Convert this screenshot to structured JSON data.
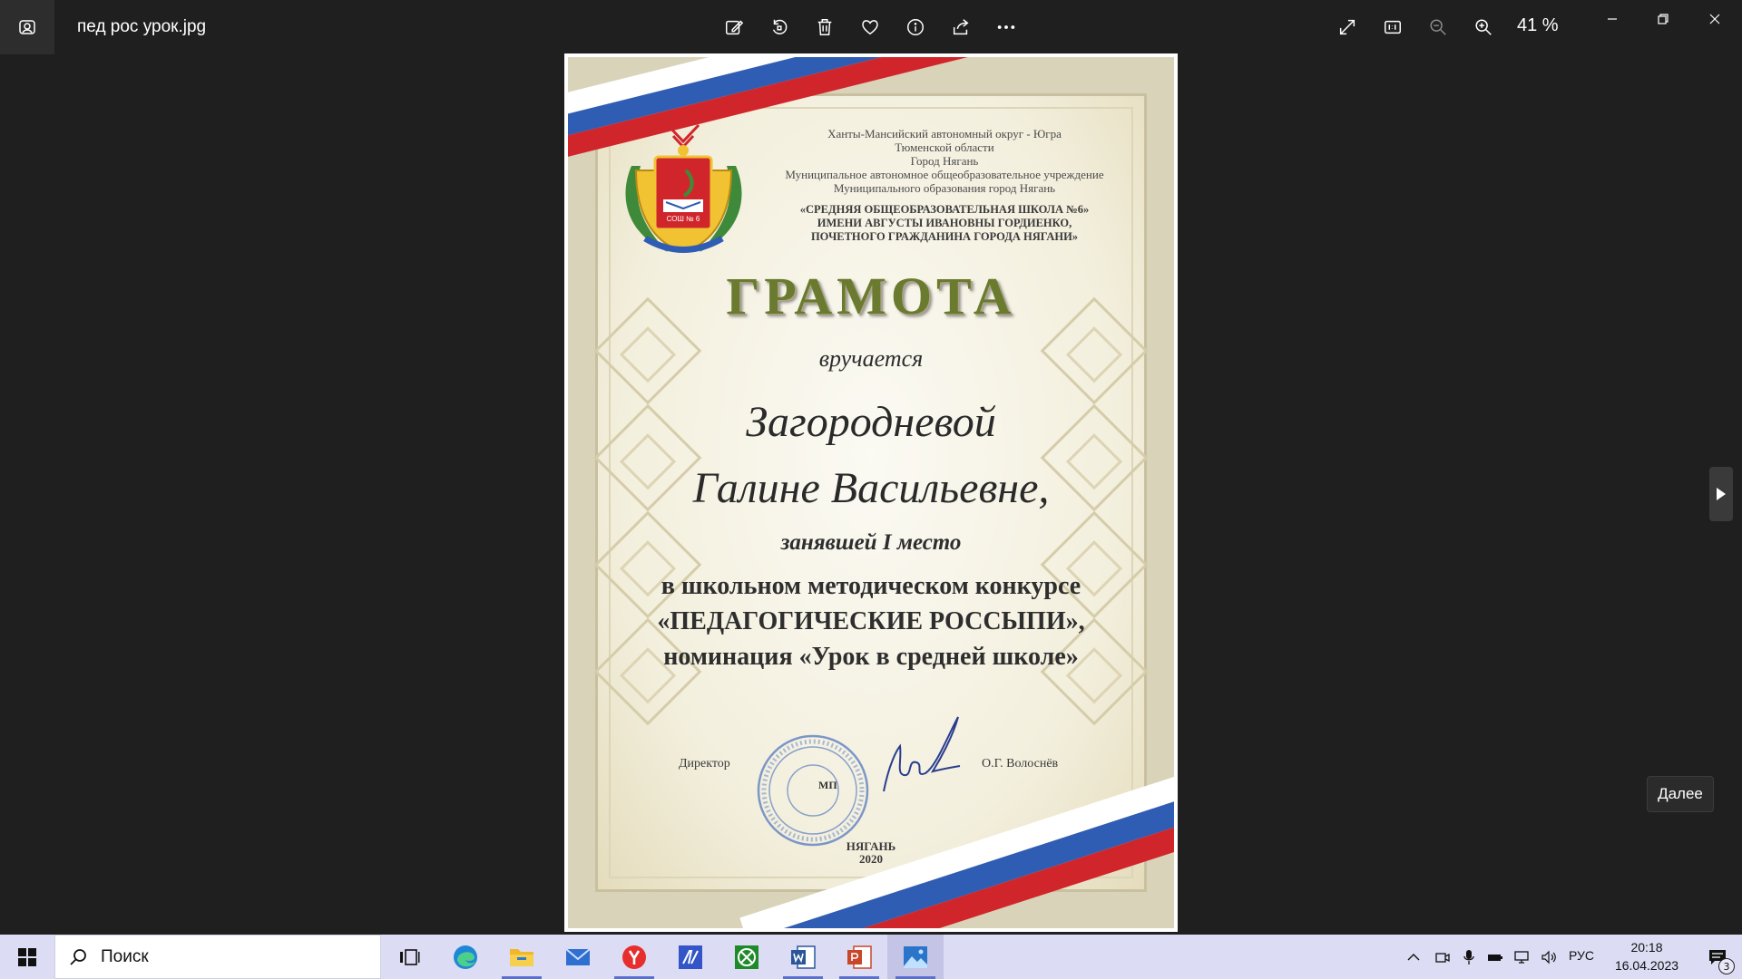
{
  "window": {
    "file_name": "пед рос урок.jpg",
    "zoom_level": "41 %"
  },
  "certificate": {
    "header_lines": [
      "Ханты-Мансийский автономный округ - Югра",
      "Тюменской области",
      "Город Нягань",
      "Муниципальное автономное общеобразовательное учреждение",
      "Муниципального образования город Нягань"
    ],
    "header_bold": [
      "«СРЕДНЯЯ ОБЩЕОБРАЗОВАТЕЛЬНАЯ ШКОЛА №6»",
      "ИМЕНИ АВГУСТЫ ИВАНОВНЫ ГОРДИЕНКО,",
      "ПОЧЕТНОГО ГРАЖДАНИНА ГОРОДА НЯГАНИ»"
    ],
    "emblem_text": "СОШ № 6",
    "title": "ГРАМОТА",
    "awarded": "вручается",
    "name_line1": "Загородневой",
    "name_line2": "Галине Васильевне,",
    "place": "занявшей I место",
    "contest_line1": "в школьном методическом конкурсе",
    "contest_line2": "«ПЕДАГОГИЧЕСКИЕ РОССЫПИ»,",
    "contest_line3": "номинация «Урок в средней школе»",
    "director_label": "Директор",
    "director_name": "О.Г. Волоснёв",
    "stamp_label": "МП",
    "city": "НЯГАНЬ",
    "year": "2020"
  },
  "tooltip": {
    "next_label": "Далее"
  },
  "taskbar": {
    "search_placeholder": "Поиск",
    "language": "РУС",
    "time": "20:18",
    "date": "16.04.2023",
    "notification_count": "3"
  },
  "colors": {
    "app_background": "#1f1f1f",
    "taskbar_background": "#dcdcf4",
    "title_green": "#6a7a2e",
    "flag_white": "#ffffff",
    "flag_blue": "#2f5db3",
    "flag_red": "#d0262b",
    "stamp_blue": "#5d7fc1"
  }
}
